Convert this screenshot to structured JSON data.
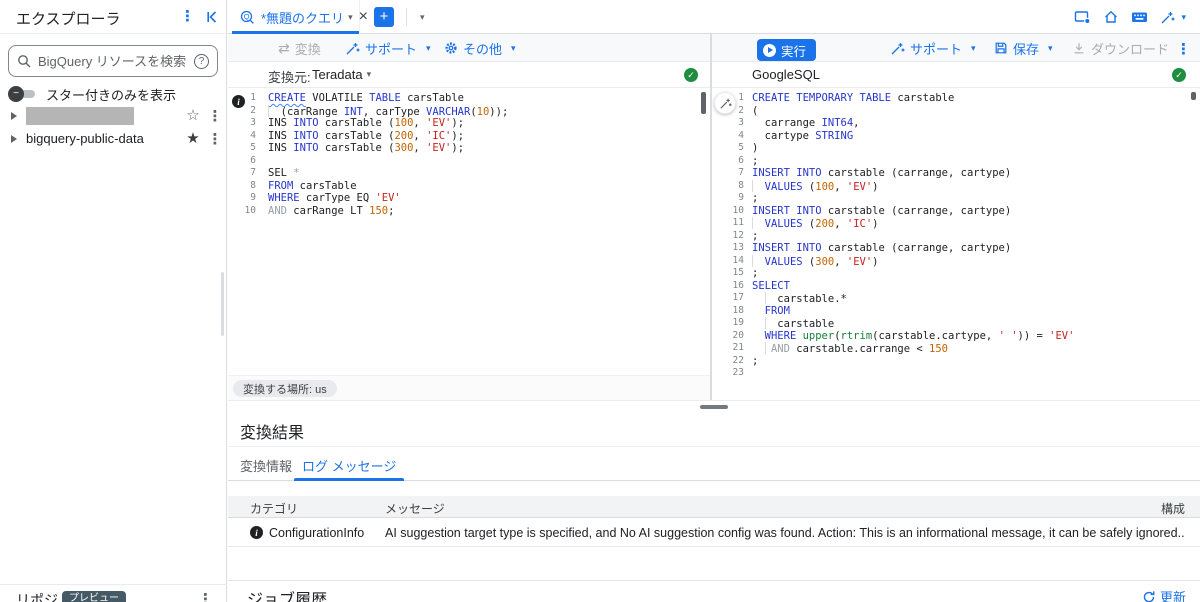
{
  "sidebar": {
    "title": "エクスプローラ",
    "search_placeholder": "BigQuery リソースを検索",
    "toggle_label": "スター付きのみを表示",
    "tree_item_2": "bigquery-public-data",
    "bottom_label": "リポジトリ",
    "bottom_badge": "プレビュー"
  },
  "tabbar": {
    "tab_title": "*無題のクエリ"
  },
  "left_pane": {
    "translate_label": "変換",
    "support_label": "サポート",
    "more_label": "その他",
    "source_label": "変換元:",
    "source_dialect": "Teradata",
    "location_badge": "変換する場所: us"
  },
  "right_pane": {
    "run_label": "実行",
    "support_label": "サポート",
    "save_label": "保存",
    "download_label": "ダウンロード",
    "dialect": "GoogleSQL"
  },
  "editors": {
    "left": {
      "language": "Teradata",
      "lines": [
        [
          [
            "ku",
            "CREATE"
          ],
          [
            "d",
            " VOLATILE "
          ],
          [
            "k",
            "TABLE"
          ],
          [
            "d",
            " carsTable"
          ]
        ],
        [
          [
            "guide",
            ""
          ],
          [
            "d",
            "  (carRange "
          ],
          [
            "k",
            "INT"
          ],
          [
            "d",
            ", carType "
          ],
          [
            "k",
            "VARCHAR"
          ],
          [
            "d",
            "("
          ],
          [
            "n",
            "10"
          ],
          [
            "d",
            "));"
          ]
        ],
        [
          [
            "d",
            "INS "
          ],
          [
            "k",
            "INTO"
          ],
          [
            "d",
            " carsTable ("
          ],
          [
            "n",
            "100"
          ],
          [
            "d",
            ", "
          ],
          [
            "s",
            "'EV'"
          ],
          [
            "d",
            ");"
          ]
        ],
        [
          [
            "d",
            "INS "
          ],
          [
            "k",
            "INTO"
          ],
          [
            "d",
            " carsTable ("
          ],
          [
            "n",
            "200"
          ],
          [
            "d",
            ", "
          ],
          [
            "s",
            "'IC'"
          ],
          [
            "d",
            ");"
          ]
        ],
        [
          [
            "d",
            "INS "
          ],
          [
            "k",
            "INTO"
          ],
          [
            "d",
            " carsTable ("
          ],
          [
            "n",
            "300"
          ],
          [
            "d",
            ", "
          ],
          [
            "s",
            "'EV'"
          ],
          [
            "d",
            ");"
          ]
        ],
        [],
        [
          [
            "d",
            "SEL "
          ],
          [
            "g",
            "*"
          ]
        ],
        [
          [
            "k",
            "FROM"
          ],
          [
            "d",
            " carsTable"
          ]
        ],
        [
          [
            "k",
            "WHERE"
          ],
          [
            "d",
            " carType EQ "
          ],
          [
            "s",
            "'EV'"
          ]
        ],
        [
          [
            "g",
            "AND"
          ],
          [
            "d",
            " carRange LT "
          ],
          [
            "n",
            "150"
          ],
          [
            "d",
            ";"
          ]
        ]
      ]
    },
    "right": {
      "language": "GoogleSQL",
      "lines": [
        [
          [
            "k",
            "CREATE TEMPORARY TABLE"
          ],
          [
            "d",
            " carstable"
          ]
        ],
        [
          [
            "d",
            "("
          ]
        ],
        [
          [
            "d",
            "  carrange "
          ],
          [
            "k",
            "INT64"
          ],
          [
            "d",
            ","
          ]
        ],
        [
          [
            "d",
            "  cartype "
          ],
          [
            "k",
            "STRING"
          ]
        ],
        [
          [
            "d",
            ")"
          ]
        ],
        [
          [
            "d",
            ";"
          ]
        ],
        [
          [
            "k",
            "INSERT INTO"
          ],
          [
            "d",
            " carstable (carrange, cartype)"
          ]
        ],
        [
          [
            "guide",
            ""
          ],
          [
            "d",
            "  "
          ],
          [
            "k",
            "VALUES"
          ],
          [
            "d",
            " ("
          ],
          [
            "n",
            "100"
          ],
          [
            "d",
            ", "
          ],
          [
            "s",
            "'EV'"
          ],
          [
            "d",
            ")"
          ]
        ],
        [
          [
            "d",
            ";"
          ]
        ],
        [
          [
            "k",
            "INSERT INTO"
          ],
          [
            "d",
            " carstable (carrange, cartype)"
          ]
        ],
        [
          [
            "guide",
            ""
          ],
          [
            "d",
            "  "
          ],
          [
            "k",
            "VALUES"
          ],
          [
            "d",
            " ("
          ],
          [
            "n",
            "200"
          ],
          [
            "d",
            ", "
          ],
          [
            "s",
            "'IC'"
          ],
          [
            "d",
            ")"
          ]
        ],
        [
          [
            "d",
            ";"
          ]
        ],
        [
          [
            "k",
            "INSERT INTO"
          ],
          [
            "d",
            " carstable (carrange, cartype)"
          ]
        ],
        [
          [
            "guide",
            ""
          ],
          [
            "d",
            "  "
          ],
          [
            "k",
            "VALUES"
          ],
          [
            "d",
            " ("
          ],
          [
            "n",
            "300"
          ],
          [
            "d",
            ", "
          ],
          [
            "s",
            "'EV'"
          ],
          [
            "d",
            ")"
          ]
        ],
        [
          [
            "d",
            ";"
          ]
        ],
        [
          [
            "k",
            "SELECT"
          ]
        ],
        [
          [
            "d",
            "  "
          ],
          [
            "guide",
            ""
          ],
          [
            "d",
            "  carstable.*"
          ]
        ],
        [
          [
            "d",
            "  "
          ],
          [
            "k",
            "FROM"
          ]
        ],
        [
          [
            "d",
            "  "
          ],
          [
            "guide",
            ""
          ],
          [
            "d",
            "  carstable"
          ]
        ],
        [
          [
            "d",
            "  "
          ],
          [
            "k",
            "WHERE"
          ],
          [
            "d",
            " "
          ],
          [
            "f",
            "upper"
          ],
          [
            "d",
            "("
          ],
          [
            "f",
            "rtrim"
          ],
          [
            "d",
            "(carstable.cartype, "
          ],
          [
            "s",
            "' '"
          ],
          [
            "d",
            ")) = "
          ],
          [
            "s",
            "'EV'"
          ]
        ],
        [
          [
            "d",
            "  "
          ],
          [
            "guide",
            ""
          ],
          [
            "d",
            " "
          ],
          [
            "g",
            "AND"
          ],
          [
            "d",
            " carstable.carrange < "
          ],
          [
            "n",
            "150"
          ]
        ],
        [
          [
            "d",
            ";"
          ]
        ],
        []
      ]
    }
  },
  "results": {
    "title": "変換結果",
    "tabs": [
      "変換情報",
      "ログ メッセージ"
    ],
    "active_tab": "ログ メッセージ",
    "columns": [
      "カテゴリ",
      "メッセージ",
      "構成"
    ],
    "rows": [
      {
        "category": "ConfigurationInfo",
        "message": "AI suggestion target type is specified, and No AI suggestion config was found. Action: This is an informational message, it can be safely ignored.."
      }
    ]
  },
  "footer": {
    "jobs_title": "ジョブ履歴",
    "refresh_label": "更新"
  },
  "icons": {
    "kebab": "⋮",
    "caret_down": "▾",
    "swap": "⇄",
    "close": "×",
    "plus": "+",
    "star_outline": "☆",
    "star_filled": "★",
    "check": "✓",
    "info": "i",
    "help": "?",
    "minus": "−"
  },
  "colors": {
    "accent_blue": "#1a73e8",
    "success_green": "#1e8e3e",
    "keyword_blue": "#2536cd",
    "string_red": "#c5221f",
    "number_orange": "#c26401",
    "function_green": "#188038",
    "muted_gray": "#9aa0a6",
    "badge_bg": "#455a64"
  }
}
